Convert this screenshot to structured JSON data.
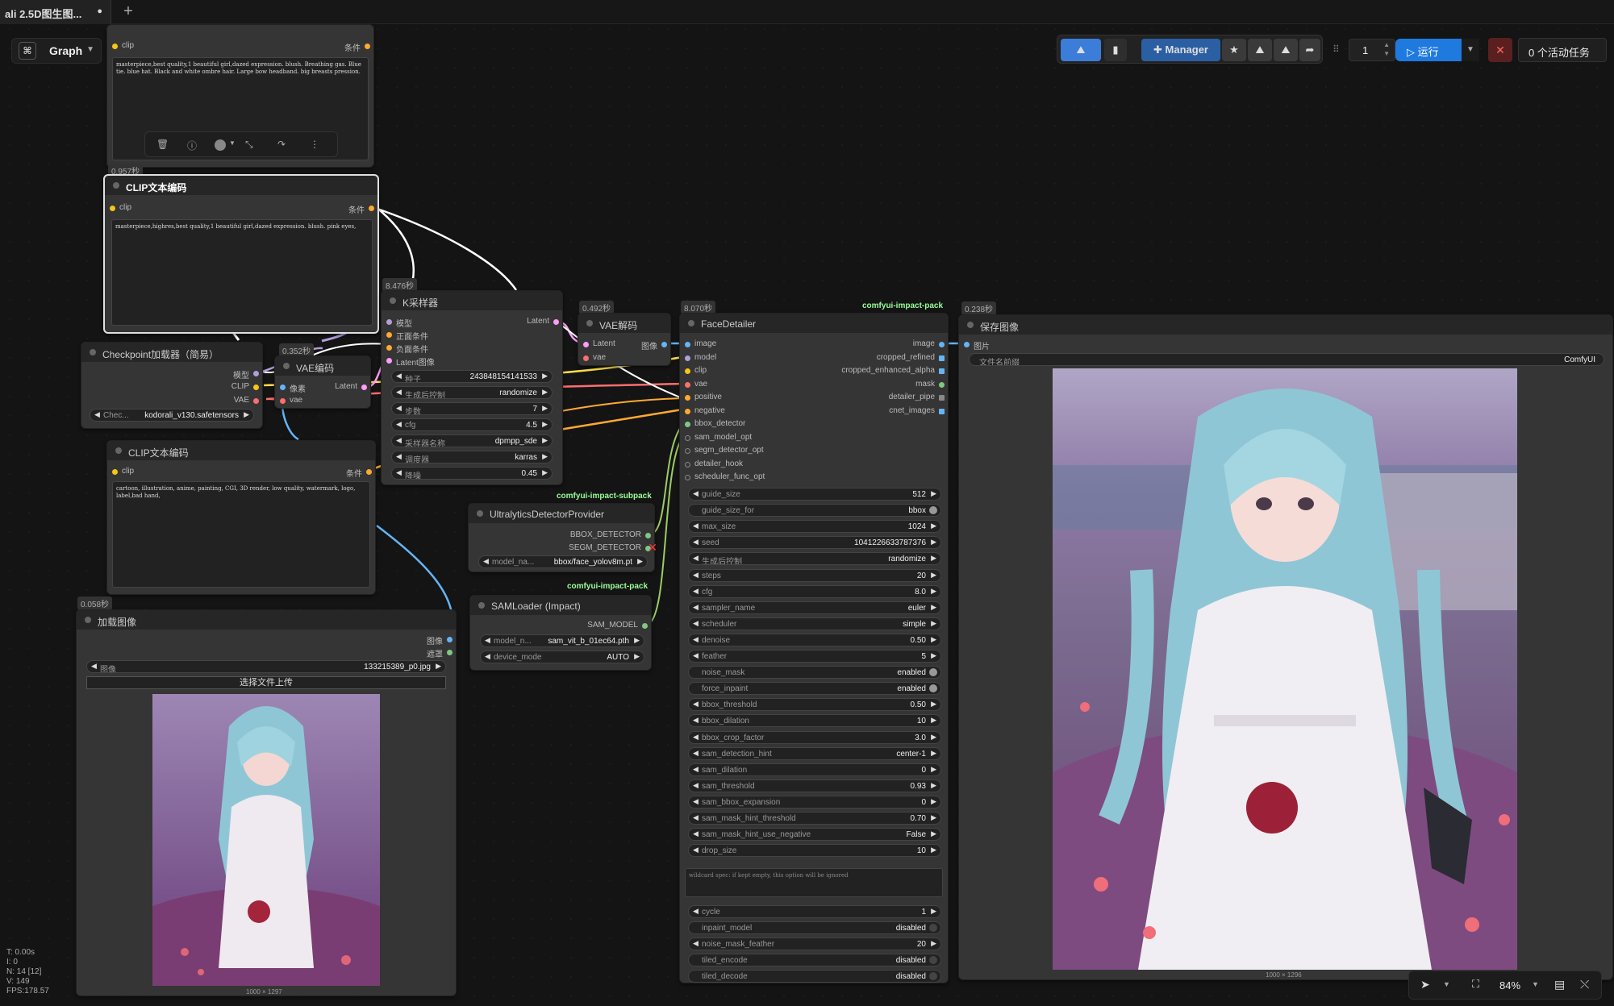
{
  "tabs": {
    "active_label": "ali 2.5D图生图...",
    "unsaved_dot": "●",
    "new_tab": "+"
  },
  "graph": {
    "label": "Graph"
  },
  "toolbar": {
    "manager": "Manager",
    "queue_count": "1",
    "run": "运行",
    "active_tasks": "0 个活动任务"
  },
  "nodes": {
    "clip_top": {
      "slot_in": "clip",
      "slot_out": "条件",
      "text": "masterpiece,best quality,1 beautiful girl,dazed expression. blush. Breathing gas. Blue tie. blue hat. Black and white ombre hair. Large bow headband. big breasts pression."
    },
    "clip_pos": {
      "time": "0.957秒",
      "title": "CLIP文本编码",
      "slot_in": "clip",
      "slot_out": "条件",
      "text": "masterpiece,highres,best quality,1 beautiful girl,dazed expression. blush. pink eyes,"
    },
    "clip_neg": {
      "title": "CLIP文本编码",
      "slot_in": "clip",
      "slot_out": "条件",
      "text": "cartoon, illustration, anime, painting, CGI, 3D render, low quality, watermark, logo, label,bad hand,"
    },
    "checkpoint": {
      "title": "Checkpoint加载器（简易）",
      "out_model": "模型",
      "out_clip": "CLIP",
      "out_vae": "VAE",
      "w_label": "Chec...",
      "w_value": "kodorali_v130.safetensors"
    },
    "vae_encode": {
      "time": "0.352秒",
      "title": "VAE编码",
      "in_pixels": "像素",
      "in_vae": "vae",
      "out_latent": "Latent"
    },
    "ksampler": {
      "time": "8.476秒",
      "title": "K采样器",
      "in_model": "模型",
      "in_pos": "正面条件",
      "in_neg": "负面条件",
      "in_latent": "Latent图像",
      "out_latent": "Latent",
      "widgets": [
        {
          "label": "种子",
          "value": "243848154141533"
        },
        {
          "label": "生成后控制",
          "value": "randomize"
        },
        {
          "label": "步数",
          "value": "7"
        },
        {
          "label": "cfg",
          "value": "4.5"
        },
        {
          "label": "采样器名称",
          "value": "dpmpp_sde"
        },
        {
          "label": "调度器",
          "value": "karras"
        },
        {
          "label": "降噪",
          "value": "0.45"
        }
      ]
    },
    "vae_decode": {
      "time": "0.492秒",
      "title": "VAE解码",
      "in_latent": "Latent",
      "in_vae": "vae",
      "out_image": "图像"
    },
    "ultralytics": {
      "pack": "comfyui-impact-subpack",
      "title": "UltralyticsDetectorProvider",
      "out_bbox": "BBOX_DETECTOR",
      "out_segm": "SEGM_DETECTOR",
      "w_label": "model_na...",
      "w_value": "bbox/face_yolov8m.pt"
    },
    "samloader": {
      "pack": "comfyui-impact-pack",
      "title": "SAMLoader (Impact)",
      "out": "SAM_MODEL",
      "w1_label": "model_n...",
      "w1_value": "sam_vit_b_01ec64.pth",
      "w2_label": "device_mode",
      "w2_value": "AUTO"
    },
    "load_image": {
      "time": "0.058秒",
      "title": "加载图像",
      "out_image": "图像",
      "out_mask": "遮罩",
      "w_label": "图像",
      "w_value": "133215389_p0.jpg",
      "upload": "选择文件上传",
      "dims": "1000 × 1297"
    },
    "face_detailer": {
      "time": "8.070秒",
      "pack": "comfyui-impact-pack",
      "title": "FaceDetailer",
      "inputs": [
        "image",
        "model",
        "clip",
        "vae",
        "positive",
        "negative",
        "bbox_detector",
        "sam_model_opt",
        "segm_detector_opt",
        "detailer_hook",
        "scheduler_func_opt"
      ],
      "outputs": [
        "image",
        "cropped_refined",
        "cropped_enhanced_alpha",
        "mask",
        "detailer_pipe",
        "cnet_images"
      ],
      "widgets": [
        {
          "label": "guide_size",
          "value": "512"
        },
        {
          "label": "guide_size_for",
          "value": "bbox"
        },
        {
          "label": "max_size",
          "value": "1024"
        },
        {
          "label": "seed",
          "value": "1041226633787376"
        },
        {
          "label": "生成后控制",
          "value": "randomize"
        },
        {
          "label": "steps",
          "value": "20"
        },
        {
          "label": "cfg",
          "value": "8.0"
        },
        {
          "label": "sampler_name",
          "value": "euler"
        },
        {
          "label": "scheduler",
          "value": "simple"
        },
        {
          "label": "denoise",
          "value": "0.50"
        },
        {
          "label": "feather",
          "value": "5"
        },
        {
          "label": "noise_mask",
          "value": "enabled"
        },
        {
          "label": "force_inpaint",
          "value": "enabled"
        },
        {
          "label": "bbox_threshold",
          "value": "0.50"
        },
        {
          "label": "bbox_dilation",
          "value": "10"
        },
        {
          "label": "bbox_crop_factor",
          "value": "3.0"
        },
        {
          "label": "sam_detection_hint",
          "value": "center-1"
        },
        {
          "label": "sam_dilation",
          "value": "0"
        },
        {
          "label": "sam_threshold",
          "value": "0.93"
        },
        {
          "label": "sam_bbox_expansion",
          "value": "0"
        },
        {
          "label": "sam_mask_hint_threshold",
          "value": "0.70"
        },
        {
          "label": "sam_mask_hint_use_negative",
          "value": "False"
        },
        {
          "label": "drop_size",
          "value": "10"
        }
      ],
      "wildcard": "wildcard spec: if kept empty, this option will be ignored",
      "widgets2": [
        {
          "label": "cycle",
          "value": "1"
        },
        {
          "label": "inpaint_model",
          "value": "disabled"
        },
        {
          "label": "noise_mask_feather",
          "value": "20"
        },
        {
          "label": "tiled_encode",
          "value": "disabled"
        },
        {
          "label": "tiled_decode",
          "value": "disabled"
        }
      ]
    },
    "save_image": {
      "time": "0.238秒",
      "title": "保存图像",
      "in_image": "图片",
      "w_label": "文件名前缀",
      "w_value": "ComfyUI",
      "dims": "1000 × 1296"
    }
  },
  "stats": [
    "T: 0.00s",
    "I: 0",
    "N: 14 [12]",
    "V: 149",
    "FPS:178.57"
  ],
  "zoom": {
    "value": "84%"
  },
  "colors": {
    "accent": "#2d7de0",
    "clip_pin": "#f5c518",
    "cond_pin": "#ffa931",
    "model_pin": "#b39ddb",
    "vae_pin": "#ff6e6e",
    "latent_pin": "#ff9cf9",
    "image_pin": "#64b5f6",
    "mask_pin": "#81c784"
  }
}
